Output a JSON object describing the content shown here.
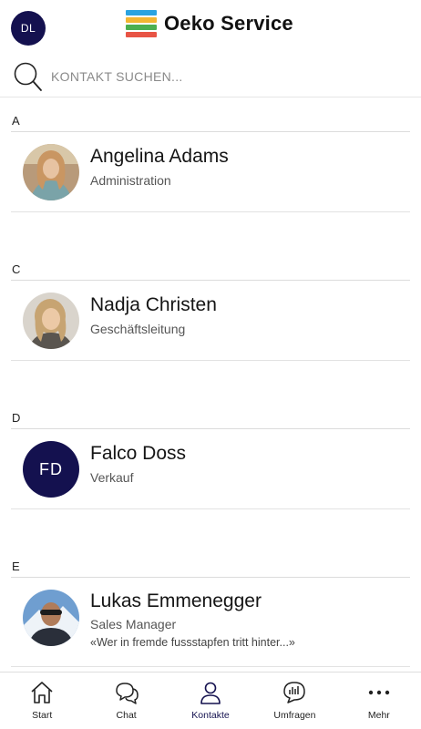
{
  "header": {
    "user_initials": "DL",
    "brand_name": "Oeko Service",
    "logo_colors": [
      "#2aa3e0",
      "#f2b632",
      "#4caf50",
      "#e85445"
    ]
  },
  "search": {
    "placeholder": "KONTAKT SUCHEN..."
  },
  "sections": [
    {
      "letter": "A",
      "contacts": [
        {
          "name": "Angelina Adams",
          "role": "Administration",
          "avatar": "photo"
        }
      ]
    },
    {
      "letter": "C",
      "contacts": [
        {
          "name": "Nadja Christen",
          "role": "Geschäftsleitung",
          "avatar": "photo"
        }
      ]
    },
    {
      "letter": "D",
      "contacts": [
        {
          "name": "Falco Doss",
          "role": "Verkauf",
          "avatar": "initials",
          "initials": "FD"
        }
      ]
    },
    {
      "letter": "E",
      "contacts": [
        {
          "name": "Lukas Emmenegger",
          "role": "Sales Manager",
          "status": "«Wer in fremde fussstapfen tritt hinter...»",
          "avatar": "photo"
        }
      ]
    }
  ],
  "tabbar": {
    "tabs": [
      {
        "label": "Start",
        "icon": "home-icon"
      },
      {
        "label": "Chat",
        "icon": "chat-icon"
      },
      {
        "label": "Kontakte",
        "icon": "person-icon",
        "active": true
      },
      {
        "label": "Umfragen",
        "icon": "poll-icon"
      },
      {
        "label": "Mehr",
        "icon": "more-icon"
      }
    ]
  },
  "colors": {
    "accent": "#14114f",
    "divider": "#dcdcdc"
  }
}
